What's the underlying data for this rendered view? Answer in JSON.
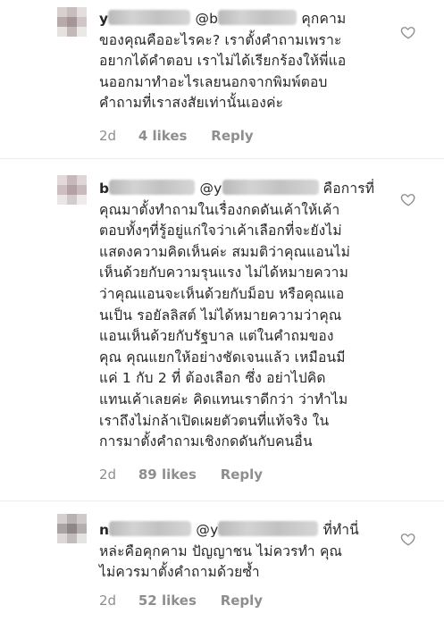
{
  "comments": [
    {
      "handle": "y",
      "mention": "@b",
      "lines": [
        "ของคุณคืออะไรคะ? เราตั้งคำถามเพราะ",
        "อยากได้คำตอบ เราไม่ได้เรียกร้องให้พี่แอ",
        "นออกมาทำอะไรเลยนอกจากพิมพ์ตอบ",
        "คำถามที่เราสงสัยเท่านั้นเองค่ะ"
      ],
      "first_line_tail": "คุกคาม",
      "time": "2d",
      "likes": "4 likes",
      "reply": "Reply"
    },
    {
      "handle": "b",
      "mention": "@y",
      "first_line_tail": "คือการที่",
      "lines": [
        "คุณมาตั้งทำถามในเรื่องกดดันเค้าให้เค้า",
        "ตอบทั้งๆที่รู้อยู่แก่ใจว่าเค้าเลือกที่จะยังไม่",
        "แสดงความคิดเห็นค่ะ สมมติว่าคุณแอนไม่",
        "เห็นด้วยกับความรุนแรง ไม่ได้หมายความ",
        "ว่าคุณแอนจะเห็นด้วยกับม็อบ หรือคุณแอ",
        "นเป็น รอยัลลิสต์ ไม่ได้หมายความว่าคุณ",
        "แอนเห็นด้วยกับรัฐบาล แต่ในคำถมของ",
        "คุณ คุณแยกให้อย่างชัดเจนแล้ว เหมือนมี",
        "แค่ 1 กับ 2 ที่ ต้องเลือก ซึ่ง อย่าไปคิด",
        "แทนเค้าเลยค่ะ คิดแทนเราดีกว่า ว่าทำไม",
        "เราถึงไม่กล้าเปิดเผยตัวตนที่แท้จริง ใน",
        "การมาตั้งคำถามเชิงกดดันกับคนอื่น"
      ],
      "time": "2d",
      "likes": "89 likes",
      "reply": "Reply"
    },
    {
      "handle": "n",
      "mention": "@y",
      "first_line_tail": "ที่ทำนี่",
      "lines": [
        "หล่ะคือคุกคาม ปัญญาชน ไม่ควรทำ คุณ",
        "ไม่ควรมาตั้งคำถามด้วยซ้ำ"
      ],
      "time": "2d",
      "likes": "52 likes",
      "reply": "Reply"
    }
  ],
  "colors": {
    "text": "#262626",
    "meta": "#8e8e8e",
    "heart": "#8e8e8e"
  },
  "icons": {
    "like": "heart-outline-icon"
  }
}
